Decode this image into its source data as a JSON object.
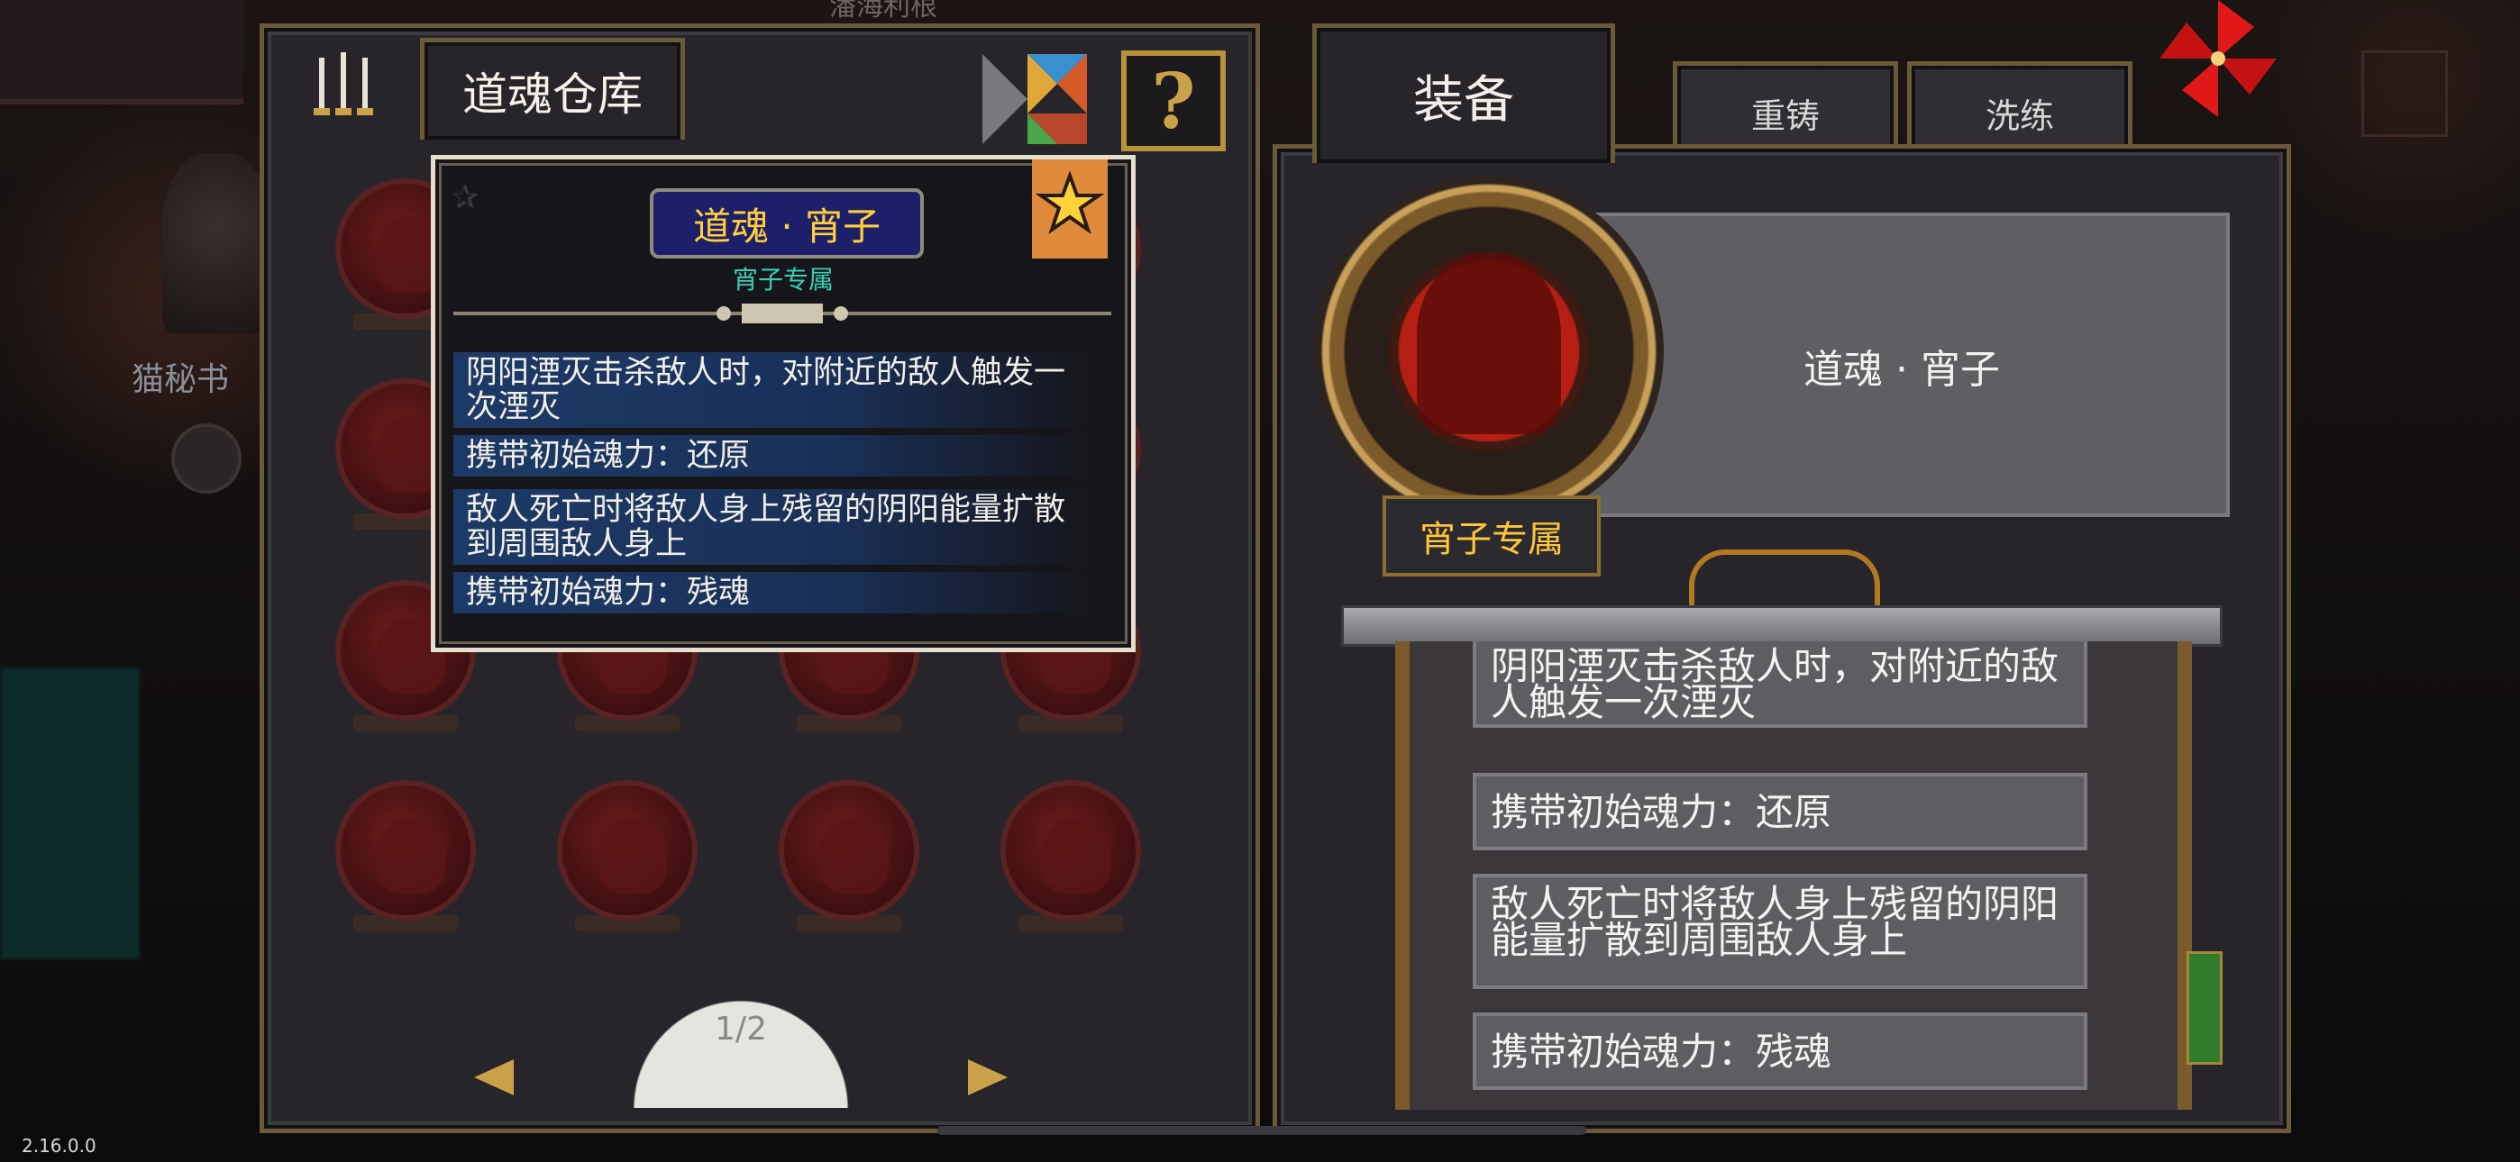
{
  "world": {
    "top_label": "潘海利根",
    "npc_label": "猫秘书",
    "version": "2.16.0.0"
  },
  "storage": {
    "title": "道魂仓库",
    "pagination": "1/2",
    "slot_count": 16
  },
  "tabs": [
    {
      "label": "装备",
      "selected": true
    },
    {
      "label": "重铸",
      "selected": false
    },
    {
      "label": "洗练",
      "selected": false
    }
  ],
  "tooltip": {
    "title": "道魂 · 宵子",
    "subtitle": "宵子专属",
    "lines": [
      "阴阳湮灭击杀敌人时，对附近的敌人触发一次湮灭",
      "携带初始魂力：还原",
      "敌人死亡时将敌人身上残留的阴阳能量扩散到周围敌人身上",
      "携带初始魂力：残魂"
    ]
  },
  "detail": {
    "name": "道魂 · 宵子",
    "exclusive": "宵子专属",
    "entries": [
      "阴阳湮灭击杀敌人时，对附近的敌人触发一次湮灭",
      "携带初始魂力：还原",
      "敌人死亡时将敌人身上残留的阴阳能量扩散到周围敌人身上",
      "携带初始魂力：残魂"
    ]
  },
  "icons": {
    "help": "?",
    "star": "✰",
    "prev": "prev-arrow-icon",
    "next": "next-arrow-icon"
  },
  "colors": {
    "accent_gold": "#ffc53a",
    "tooltip_title_bg": "#1d1f6a",
    "subtitle_teal": "#34d0b8",
    "soul_red": "#b81f14"
  }
}
